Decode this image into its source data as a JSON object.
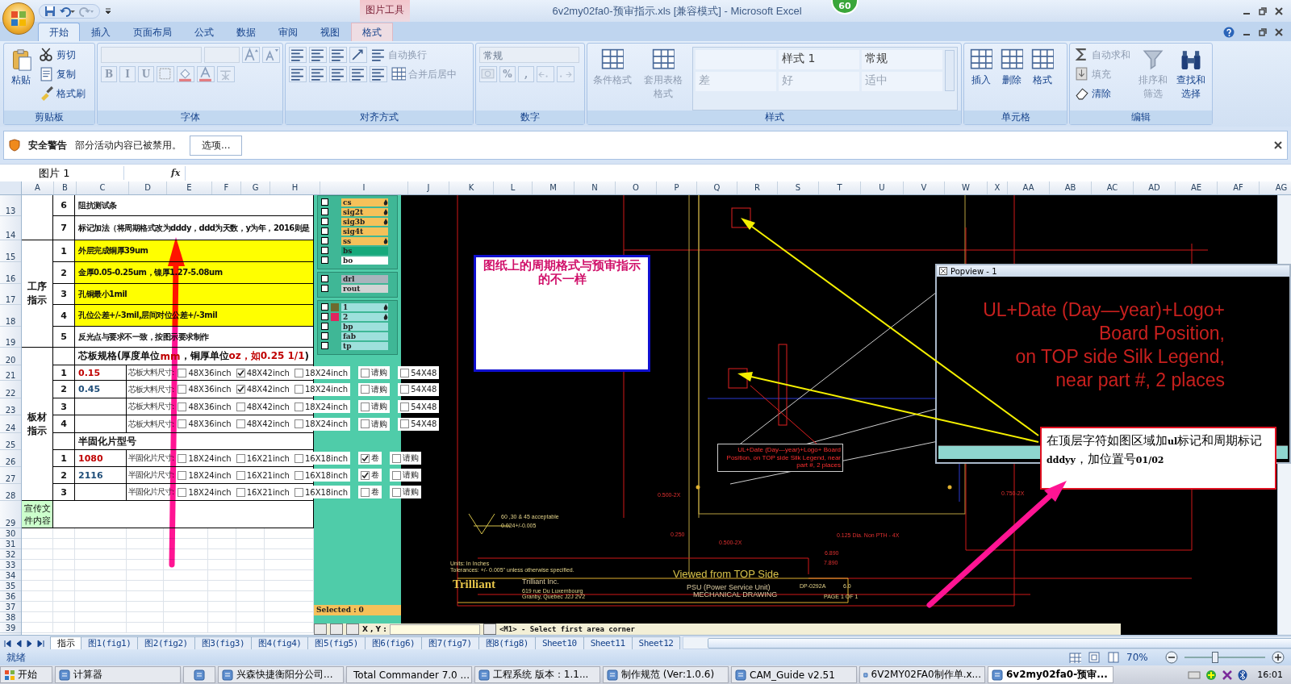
{
  "window": {
    "title": "6v2my02fa0-预审指示.xls  [兼容模式] - Microsoft Excel",
    "badge": "60",
    "context_label": "图片工具"
  },
  "tabs": [
    {
      "label": "开始",
      "selected": true,
      "kind": "normal"
    },
    {
      "label": "插入",
      "selected": false,
      "kind": "normal"
    },
    {
      "label": "页面布局",
      "selected": false,
      "kind": "normal"
    },
    {
      "label": "公式",
      "selected": false,
      "kind": "normal"
    },
    {
      "label": "数据",
      "selected": false,
      "kind": "normal"
    },
    {
      "label": "审阅",
      "selected": false,
      "kind": "normal"
    },
    {
      "label": "视图",
      "selected": false,
      "kind": "normal"
    },
    {
      "label": "格式",
      "selected": false,
      "kind": "contextual"
    }
  ],
  "ribbon": {
    "groups": [
      {
        "label": "剪贴板",
        "items": [
          {
            "kind": "large",
            "label": "粘贴",
            "disabled": false
          },
          {
            "kind": "stack",
            "rows": [
              [
                {
                  "kind": "small",
                  "label": "剪切",
                  "disabled": false
                }
              ],
              [
                {
                  "kind": "small",
                  "label": "复制",
                  "disabled": false
                }
              ],
              [
                {
                  "kind": "small",
                  "label": "格式刷",
                  "disabled": false
                }
              ]
            ]
          }
        ]
      },
      {
        "label": "字体",
        "items": [
          {
            "kind": "stack",
            "rows": [
              [
                {
                  "kind": "field",
                  "disabled": true
                },
                {
                  "kind": "field-small",
                  "disabled": true
                },
                {
                  "kind": "icon",
                  "disabled": true
                },
                {
                  "kind": "icon",
                  "disabled": true
                }
              ],
              [
                {
                  "kind": "text",
                  "label": "B",
                  "disabled": true
                },
                {
                  "kind": "text",
                  "label": "I",
                  "disabled": true
                },
                {
                  "kind": "text",
                  "label": "U",
                  "disabled": true
                },
                {
                  "kind": "icon",
                  "disabled": true
                },
                {
                  "kind": "icon",
                  "disabled": true
                },
                {
                  "kind": "icon",
                  "disabled": true
                },
                {
                  "kind": "icon",
                  "disabled": true
                }
              ]
            ]
          }
        ]
      },
      {
        "label": "对齐方式",
        "items": [
          {
            "kind": "stack",
            "rows": [
              [
                {
                  "kind": "icon",
                  "disabled": false
                },
                {
                  "kind": "icon",
                  "disabled": false
                },
                {
                  "kind": "icon",
                  "disabled": false
                },
                {
                  "kind": "icon",
                  "disabled": false
                },
                {
                  "kind": "small",
                  "label": "自动换行",
                  "disabled": true
                }
              ],
              [
                {
                  "kind": "icon",
                  "disabled": false
                },
                {
                  "kind": "icon",
                  "disabled": false
                },
                {
                  "kind": "icon",
                  "disabled": false
                },
                {
                  "kind": "icon",
                  "disabled": false
                },
                {
                  "kind": "icon",
                  "disabled": false
                },
                {
                  "kind": "small",
                  "label": "合并后居中",
                  "disabled": true
                }
              ]
            ]
          }
        ]
      },
      {
        "label": "数字",
        "items": [
          {
            "kind": "stack",
            "rows": [
              [
                {
                  "kind": "dropdown",
                  "label": "常规",
                  "disabled": true
                }
              ],
              [
                {
                  "kind": "icon",
                  "disabled": true
                },
                {
                  "kind": "text",
                  "label": "%",
                  "disabled": true
                },
                {
                  "kind": "text",
                  "label": ",",
                  "disabled": true
                },
                {
                  "kind": "icon",
                  "disabled": true
                },
                {
                  "kind": "icon",
                  "disabled": true
                }
              ]
            ]
          }
        ]
      },
      {
        "label": "样式",
        "items": [
          {
            "kind": "large",
            "label": "条件格式",
            "disabled": true
          },
          {
            "kind": "large",
            "label": "套用表格格式",
            "disabled": true
          },
          {
            "kind": "gallery",
            "cells": [
              "样式 1",
              "常规",
              "差",
              "好",
              "适中"
            ]
          }
        ]
      },
      {
        "label": "单元格",
        "items": [
          {
            "kind": "large",
            "label": "插入",
            "disabled": false
          },
          {
            "kind": "large",
            "label": "删除",
            "disabled": false
          },
          {
            "kind": "large",
            "label": "格式",
            "disabled": false
          }
        ]
      },
      {
        "label": "编辑",
        "items": [
          {
            "kind": "stack",
            "rows": [
              [
                {
                  "kind": "small",
                  "label": "自动求和",
                  "disabled": true
                }
              ],
              [
                {
                  "kind": "small",
                  "label": "填充",
                  "disabled": true
                }
              ],
              [
                {
                  "kind": "small",
                  "label": "清除",
                  "disabled": false
                }
              ]
            ]
          },
          {
            "kind": "large",
            "label": "排序和筛选",
            "disabled": true
          },
          {
            "kind": "large",
            "label": "查找和选择",
            "disabled": false
          }
        ]
      }
    ]
  },
  "security_bar": {
    "title": "安全警告",
    "message": "部分活动内容已被禁用。",
    "button": "选项..."
  },
  "formula_bar": {
    "name_box": "图片 1",
    "fx": "fx"
  },
  "sheet": {
    "columns": [
      "A",
      "B",
      "C",
      "D",
      "E",
      "F",
      "G",
      "H",
      "I",
      "J",
      "K",
      "L",
      "M",
      "N",
      "O",
      "P",
      "Q",
      "R",
      "S",
      "T",
      "U",
      "V",
      "W",
      "X",
      "AA",
      "AB",
      "AC",
      "AD",
      "AE",
      "AF",
      "AG"
    ],
    "row_numbers": [
      "13",
      "14",
      "15",
      "16",
      "17",
      "18",
      "19",
      "20",
      "21",
      "22",
      "23",
      "24",
      "25",
      "26",
      "27",
      "28",
      "29",
      "30",
      "31",
      "32",
      "33",
      "34",
      "35",
      "36",
      "37",
      "38",
      "39"
    ],
    "sections": [
      {
        "highlighted": false,
        "items": [
          {
            "kind": "text",
            "no": "6",
            "text": "阻抗测试条",
            "highlighted": false
          },
          {
            "kind": "text",
            "no": "7",
            "text": "标记加法（将周期格式改为dddy，ddd为天数，y为年，2016则是",
            "highlighted": false
          }
        ]
      },
      {
        "title": "工序指示",
        "highlighted": false,
        "items": [
          {
            "kind": "text",
            "no": "1",
            "text": "外层完成铜厚39um",
            "highlighted": true
          },
          {
            "kind": "text",
            "no": "2",
            "text": "金厚0.05-0.25um，镍厚1.27-5.08um",
            "highlighted": true
          },
          {
            "kind": "text",
            "no": "3",
            "text": "孔铜最小1mil",
            "highlighted": true
          },
          {
            "kind": "text",
            "no": "4",
            "text": "孔位公差+/-3mil,层间对位公差+/-3mil",
            "highlighted": true
          },
          {
            "kind": "text",
            "no": "5",
            "text": "反光点与要求不一致，按图示要求制作",
            "highlighted": false
          }
        ]
      },
      {
        "title": "板材指示",
        "highlighted": false,
        "items": [
          {
            "kind": "heading",
            "parts": [
              {
                "text": "芯板规格(厚度单位",
                "kind": "plain"
              },
              {
                "text": "mm",
                "kind": "accent"
              },
              {
                "text": "，铜厚单位",
                "kind": "plain"
              },
              {
                "text": "oz，如0.25 1/1",
                "kind": "accent"
              },
              {
                "text": ")",
                "kind": "plain"
              }
            ]
          },
          {
            "kind": "material",
            "no": "1",
            "value": "0.15",
            "color": "#c00000",
            "label": "芯板大料尺寸:",
            "options": [
              {
                "label": "48X36inch",
                "checked": false
              },
              {
                "label": "48X42inch",
                "checked": true
              },
              {
                "label": "18X24inch",
                "checked": false
              },
              {
                "label": "请购",
                "checked": false
              },
              {
                "label": "54X48",
                "checked": false
              }
            ]
          },
          {
            "kind": "material",
            "no": "2",
            "value": "0.45",
            "color": "#1f4e79",
            "label": "芯板大料尺寸:",
            "options": [
              {
                "label": "48X36inch",
                "checked": false
              },
              {
                "label": "48X42inch",
                "checked": true
              },
              {
                "label": "18X24inch",
                "checked": false
              },
              {
                "label": "请购",
                "checked": false
              },
              {
                "label": "54X48",
                "checked": false
              }
            ]
          },
          {
            "kind": "material",
            "no": "3",
            "label": "芯板大料尺寸:",
            "options": [
              {
                "label": "48X36inch",
                "checked": false
              },
              {
                "label": "48X42inch",
                "checked": false
              },
              {
                "label": "18X24inch",
                "checked": false
              },
              {
                "label": "请购",
                "checked": false
              },
              {
                "label": "54X48",
                "checked": false
              }
            ]
          },
          {
            "kind": "material",
            "no": "4",
            "label": "芯板大料尺寸:",
            "options": [
              {
                "label": "48X36inch",
                "checked": false
              },
              {
                "label": "48X42inch",
                "checked": false
              },
              {
                "label": "18X24inch",
                "checked": false
              },
              {
                "label": "请购",
                "checked": false
              },
              {
                "label": "54X48",
                "checked": false
              }
            ]
          },
          {
            "kind": "heading",
            "parts": [
              {
                "text": "半固化片型号",
                "kind": "plain"
              }
            ]
          },
          {
            "kind": "material",
            "no": "1",
            "value": "1080",
            "color": "#c00000",
            "label": "半固化片尺寸:",
            "options": [
              {
                "label": "18X24inch",
                "checked": false
              },
              {
                "label": "16X21inch",
                "checked": false
              },
              {
                "label": "16X18inch",
                "checked": false
              },
              {
                "label": "卷",
                "checked": true
              },
              {
                "label": "请购",
                "checked": false
              }
            ]
          },
          {
            "kind": "material",
            "no": "2",
            "value": "2116",
            "color": "#1f4e79",
            "label": "半固化片尺寸:",
            "options": [
              {
                "label": "18X24inch",
                "checked": false
              },
              {
                "label": "16X21inch",
                "checked": false
              },
              {
                "label": "16X18inch",
                "checked": false
              },
              {
                "label": "卷",
                "checked": true
              },
              {
                "label": "请购",
                "checked": false
              }
            ]
          },
          {
            "kind": "material",
            "no": "3",
            "label": "半固化片尺寸:",
            "options": [
              {
                "label": "18X24inch",
                "checked": false
              },
              {
                "label": "16X21inch",
                "checked": false
              },
              {
                "label": "16X18inch",
                "checked": false
              },
              {
                "label": "卷",
                "checked": false
              },
              {
                "label": "请购",
                "checked": false
              }
            ]
          }
        ]
      },
      {
        "title": "宣传文件内容",
        "highlighted": true
      }
    ]
  },
  "cam_view": {
    "layers": [
      {
        "name": "cs",
        "color": "#f5c15a",
        "marked": true,
        "checked": false
      },
      {
        "name": "sig2t",
        "color": "#f5c15a",
        "marked": true,
        "checked": false
      },
      {
        "name": "sig3b",
        "color": "#f5c15a",
        "marked": true,
        "checked": false
      },
      {
        "name": "sig4t",
        "color": "#f5c15a",
        "marked": false,
        "checked": false
      },
      {
        "name": "ss",
        "color": "#f5c15a",
        "marked": true,
        "checked": false
      },
      {
        "name": "bs",
        "color": "#17a97b",
        "marked": false,
        "checked": false
      },
      {
        "name": "bo",
        "color": "#ffffff",
        "marked": false,
        "checked": false
      },
      {
        "name": "drl",
        "color": "#a8b4bc",
        "marked": false,
        "checked": false
      },
      {
        "name": "rout",
        "color": "#d0d4d4",
        "marked": false,
        "checked": false
      },
      {
        "name": "1",
        "color": "#9ee0dc",
        "marked": true,
        "checked": false,
        "swatch": {
          "color": "#6e6a2e"
        }
      },
      {
        "name": "2",
        "color": "#9ee0dc",
        "marked": true,
        "checked": false,
        "swatch": {
          "color": "#e0245e"
        }
      },
      {
        "name": "bp",
        "color": "#9ee0dc",
        "marked": false,
        "checked": false
      },
      {
        "name": "fab",
        "color": "#9ee0dc",
        "marked": false,
        "checked": false
      },
      {
        "name": "tp",
        "color": "#9ee0dc",
        "marked": false,
        "checked": false
      }
    ],
    "selected_label": "Selected : 0",
    "coord_label": "X , Y :",
    "command": "<M1> - Select first area corner",
    "labels": [
      {
        "text": "UL+Date (Day—year)+Logo+ Board Position, on TOP side Silk Legend, near part #, 2 places",
        "kind": "legend"
      },
      {
        "text": "0.500-2X",
        "kind": "dim"
      },
      {
        "text": "0.750-2X",
        "kind": "dim"
      },
      {
        "text": "60 ,30 & 45 acceptable",
        "kind": "small"
      },
      {
        "text": "0.024+/-0.005",
        "kind": "small"
      },
      {
        "text": "0.250",
        "kind": "dim"
      },
      {
        "text": "0.125 Dia. Non PTH - 4X",
        "kind": "dim"
      },
      {
        "text": "0.500-2X",
        "kind": "dim"
      },
      {
        "text": "6.890",
        "kind": "dim"
      },
      {
        "text": "7.890",
        "kind": "dim"
      },
      {
        "text": "Units: In Inches",
        "kind": "small"
      },
      {
        "text": "Tolerances: +/- 0.005\" unless otherwise specified.",
        "kind": "small"
      },
      {
        "text": "Viewed from TOP Side",
        "kind": "title"
      },
      {
        "text": "Trilliant",
        "kind": "logo"
      },
      {
        "text": "Trilliant Inc.",
        "kind": "note"
      },
      {
        "text": "PSU (Power Service Unit)",
        "kind": "note"
      },
      {
        "text": "DP-0292A",
        "kind": "small"
      },
      {
        "text": "6.0",
        "kind": "small"
      },
      {
        "text": "619 rue Du Luxembourg",
        "kind": "small"
      },
      {
        "text": "MECHANICAL DRAWING",
        "kind": "note"
      },
      {
        "text": "Granby, Quebec J2J 2V2",
        "kind": "small"
      },
      {
        "text": "PAGE 1 OF 1",
        "kind": "small"
      }
    ]
  },
  "annotations": {
    "note": "图纸上的周期格式与预审指示的不一样",
    "instruction": "在顶层字符如图区域加**ul**标记和周期标记**dddyy**，加位置号**01/02**"
  },
  "popview": {
    "title": "Popview - 1",
    "lines": [
      "UL+Date (Day—year)+Logo+",
      "Board Position,",
      "on TOP side Silk Legend,",
      "near part #, 2 places"
    ]
  },
  "sheet_tabs": [
    {
      "label": "指示",
      "selected": true
    },
    {
      "label": "图1(fig1)",
      "selected": false
    },
    {
      "label": "图2(fig2)",
      "selected": false
    },
    {
      "label": "图3(fig3)",
      "selected": false
    },
    {
      "label": "图4(fig4)",
      "selected": false
    },
    {
      "label": "图5(fig5)",
      "selected": false
    },
    {
      "label": "图6(fig6)",
      "selected": false
    },
    {
      "label": "图7(fig7)",
      "selected": false
    },
    {
      "label": "图8(fig8)",
      "selected": false
    },
    {
      "label": "Sheet10",
      "selected": false
    },
    {
      "label": "Sheet11",
      "selected": false
    },
    {
      "label": "Sheet12",
      "selected": false
    }
  ],
  "status_bar": {
    "text": "就绪",
    "zoom": "70%",
    "zoom_slider": {
      "level": 0.37
    }
  },
  "taskbar": {
    "start": "开始",
    "items": [
      {
        "kind": "app",
        "label": "计算器",
        "selected": false
      },
      {
        "kind": "icon",
        "selected": false
      },
      {
        "kind": "app",
        "label": "兴森快捷衡阳分公司...",
        "selected": false
      },
      {
        "kind": "app",
        "label": "Total Commander 7.0 ...",
        "selected": false
      },
      {
        "kind": "app",
        "label": "工程系统  版本：1.1...",
        "selected": false
      },
      {
        "kind": "app",
        "label": "制作规范 (Ver:1.0.6)",
        "selected": false
      },
      {
        "kind": "app",
        "label": "CAM_Guide v2.51",
        "selected": false
      },
      {
        "kind": "app",
        "label": "6V2MY02FA0制作单.x...",
        "selected": false
      },
      {
        "kind": "app",
        "label": "6v2my02fa0-预审...",
        "selected": true
      }
    ],
    "clock": "16:01"
  }
}
